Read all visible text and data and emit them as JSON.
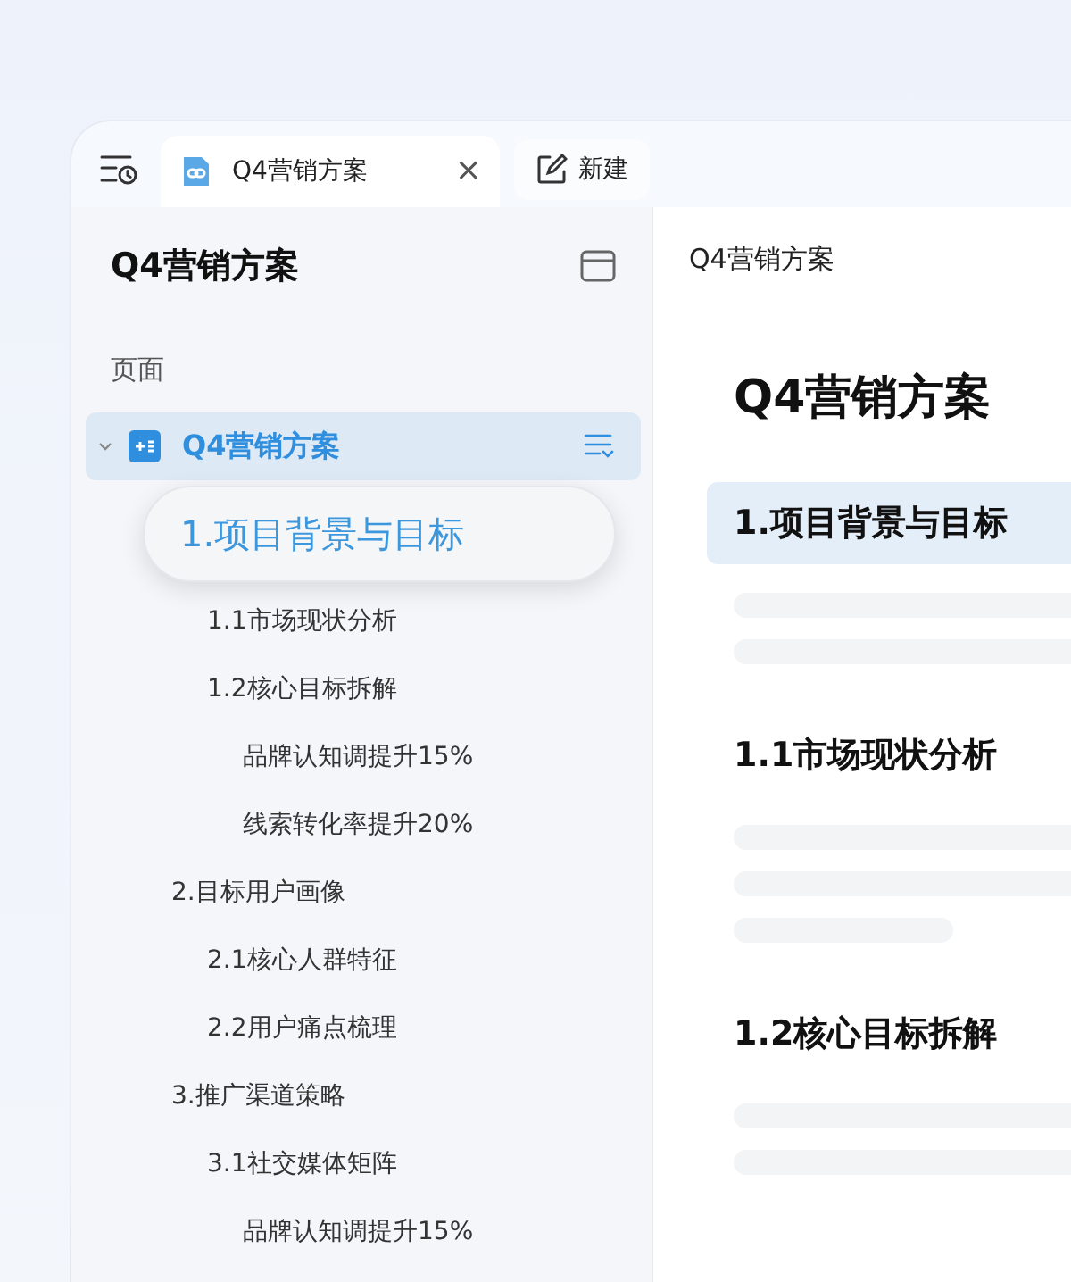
{
  "tab_bar": {
    "tabs": [
      {
        "title": "Q4营销方案",
        "close": "×",
        "selected": true
      }
    ],
    "new_button": "新建"
  },
  "sidebar": {
    "title": "Q4营销方案",
    "section_label": "页面",
    "tree": [
      {
        "label": "Q4营销方案",
        "expanded": true,
        "selected": true,
        "dragging": false,
        "children": [
          {
            "label": "1.项目背景与目标",
            "selected": false,
            "dragging": true,
            "children": [
              {
                "label": "1.1市场现状分析",
                "selected": false,
                "dragging": false
              },
              {
                "label": "1.2核心目标拆解",
                "selected": false,
                "dragging": false,
                "children": [
                  {
                    "label": "品牌认知调提升15%",
                    "selected": false,
                    "dragging": false
                  },
                  {
                    "label": "线索转化率提升20%",
                    "selected": false,
                    "dragging": false
                  }
                ]
              }
            ]
          },
          {
            "label": "2.目标用户画像",
            "selected": false,
            "dragging": false,
            "children": [
              {
                "label": "2.1核心人群特征",
                "selected": false,
                "dragging": false
              },
              {
                "label": "2.2用户痛点梳理",
                "selected": false,
                "dragging": false
              }
            ]
          },
          {
            "label": "3.推广渠道策略",
            "selected": false,
            "dragging": false,
            "children": [
              {
                "label": "3.1社交媒体矩阵",
                "selected": false,
                "dragging": false,
                "children": [
                  {
                    "label": "品牌认知调提升15%",
                    "selected": false,
                    "dragging": false
                  }
                ]
              }
            ]
          }
        ]
      }
    ]
  },
  "document": {
    "breadcrumb": "Q4营销方案",
    "title": "Q4营销方案",
    "sections": [
      {
        "heading": "1.项目背景与目标",
        "highlighted": true,
        "lines": [
          {
            "kind": "full"
          },
          {
            "kind": "full"
          }
        ]
      },
      {
        "heading": "1.1市场现状分析",
        "highlighted": false,
        "lines": [
          {
            "kind": "full"
          },
          {
            "kind": "full"
          },
          {
            "kind": "short"
          }
        ]
      },
      {
        "heading": "1.2核心目标拆解",
        "highlighted": false,
        "lines": [
          {
            "kind": "full"
          },
          {
            "kind": "full"
          }
        ]
      }
    ]
  }
}
